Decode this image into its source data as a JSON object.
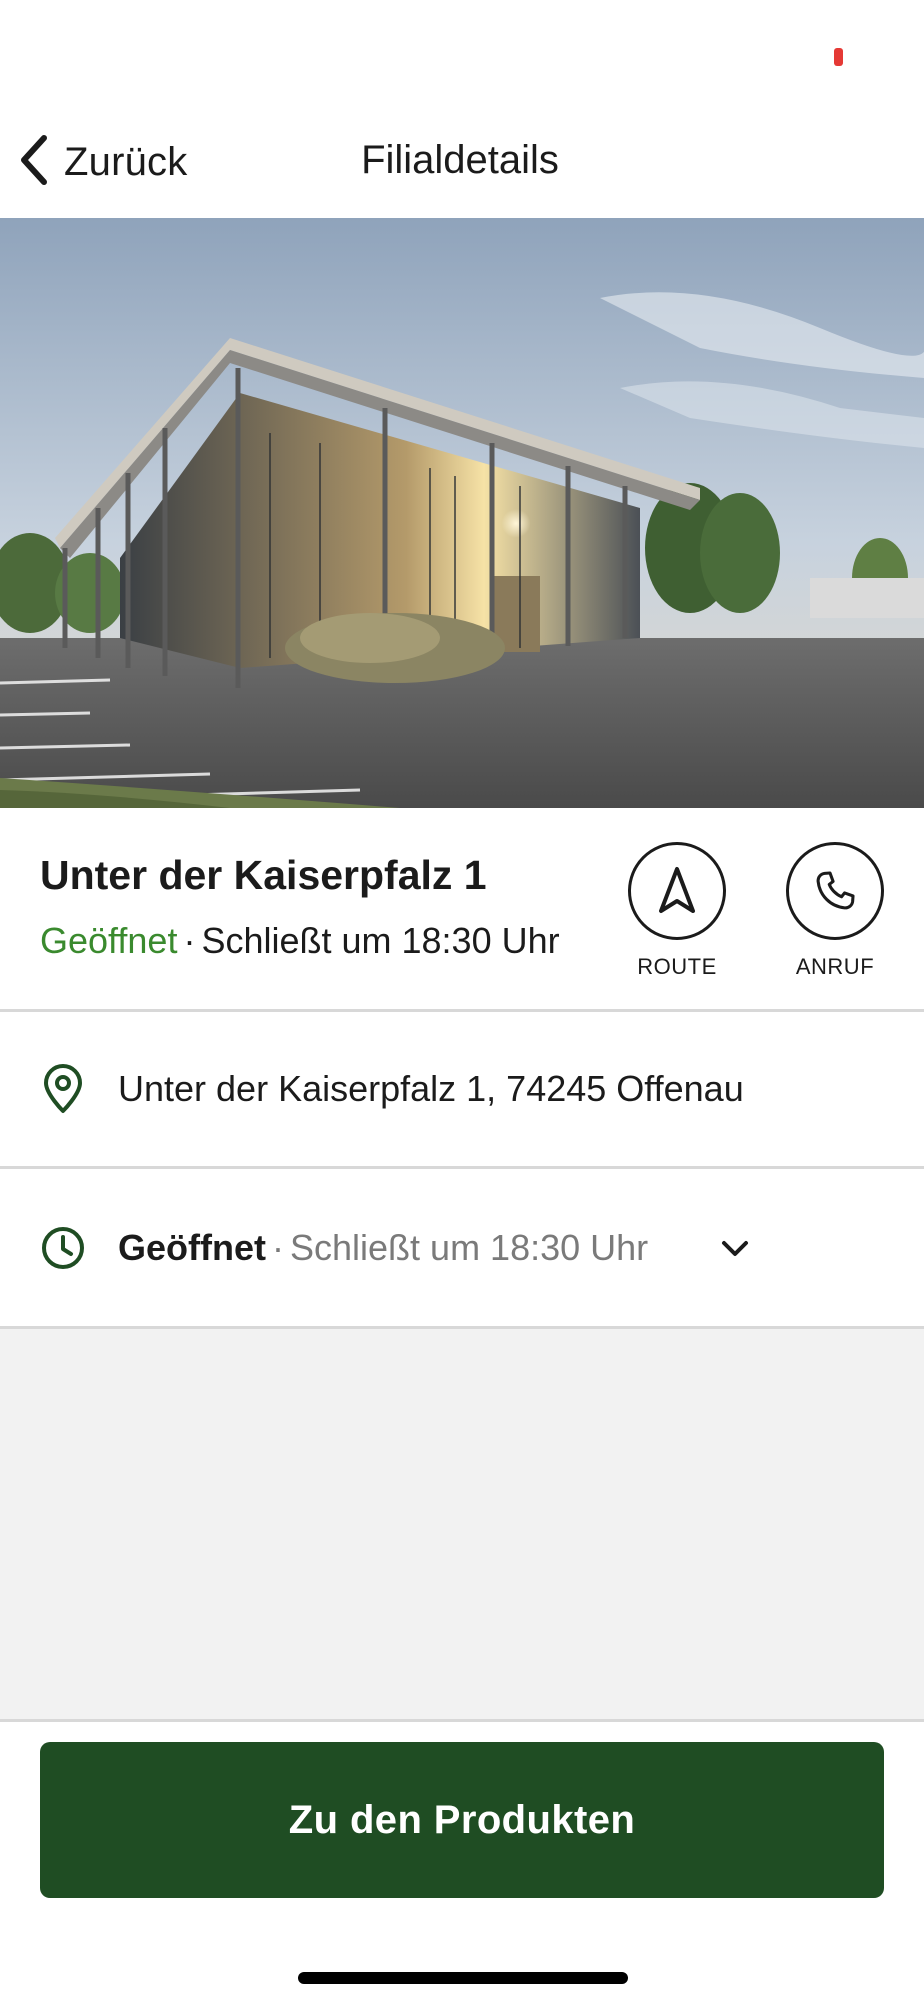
{
  "colors": {
    "accent_green": "#3a8a2e",
    "button_dark_green": "#1f4d23",
    "status_indicator": "#e53935"
  },
  "nav": {
    "back_label": "Zurück",
    "title": "Filialdetails"
  },
  "store": {
    "name": "Unter der Kaiserpfalz 1",
    "status_open": "Geöffnet",
    "status_separator": "·",
    "status_close": "Schließt um 18:30 Uhr"
  },
  "actions": {
    "route_label": "ROUTE",
    "call_label": "ANRUF"
  },
  "address": {
    "text": "Unter der Kaiserpfalz 1, 74245 Offenau"
  },
  "hours": {
    "open": "Geöffnet",
    "separator": "·",
    "close": "Schließt um 18:30 Uhr"
  },
  "cta": {
    "label": "Zu den Produkten"
  },
  "icons": {
    "back": "chevron-left-icon",
    "route": "navigation-arrow-icon",
    "call": "phone-icon",
    "location": "location-pin-icon",
    "clock": "clock-icon",
    "expand": "chevron-down-icon"
  }
}
